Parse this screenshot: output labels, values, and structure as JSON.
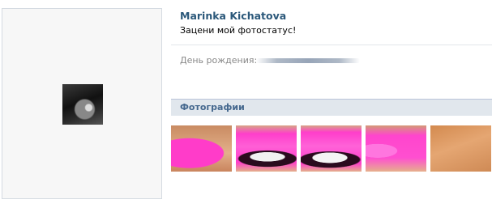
{
  "profile": {
    "name": "Marinka Kichatova",
    "status": "Зацени мой фотостатус!"
  },
  "info": {
    "birthday_label": "День рождения:"
  },
  "photos_section": {
    "title": "Фотографии",
    "items": [
      {
        "name": "photo-1"
      },
      {
        "name": "photo-2"
      },
      {
        "name": "photo-3"
      },
      {
        "name": "photo-4"
      },
      {
        "name": "photo-5"
      }
    ]
  },
  "colors": {
    "name_link": "#2b587a",
    "section_bar_bg": "#e1e7ed",
    "section_title": "#45688e",
    "label_gray": "#888888"
  }
}
